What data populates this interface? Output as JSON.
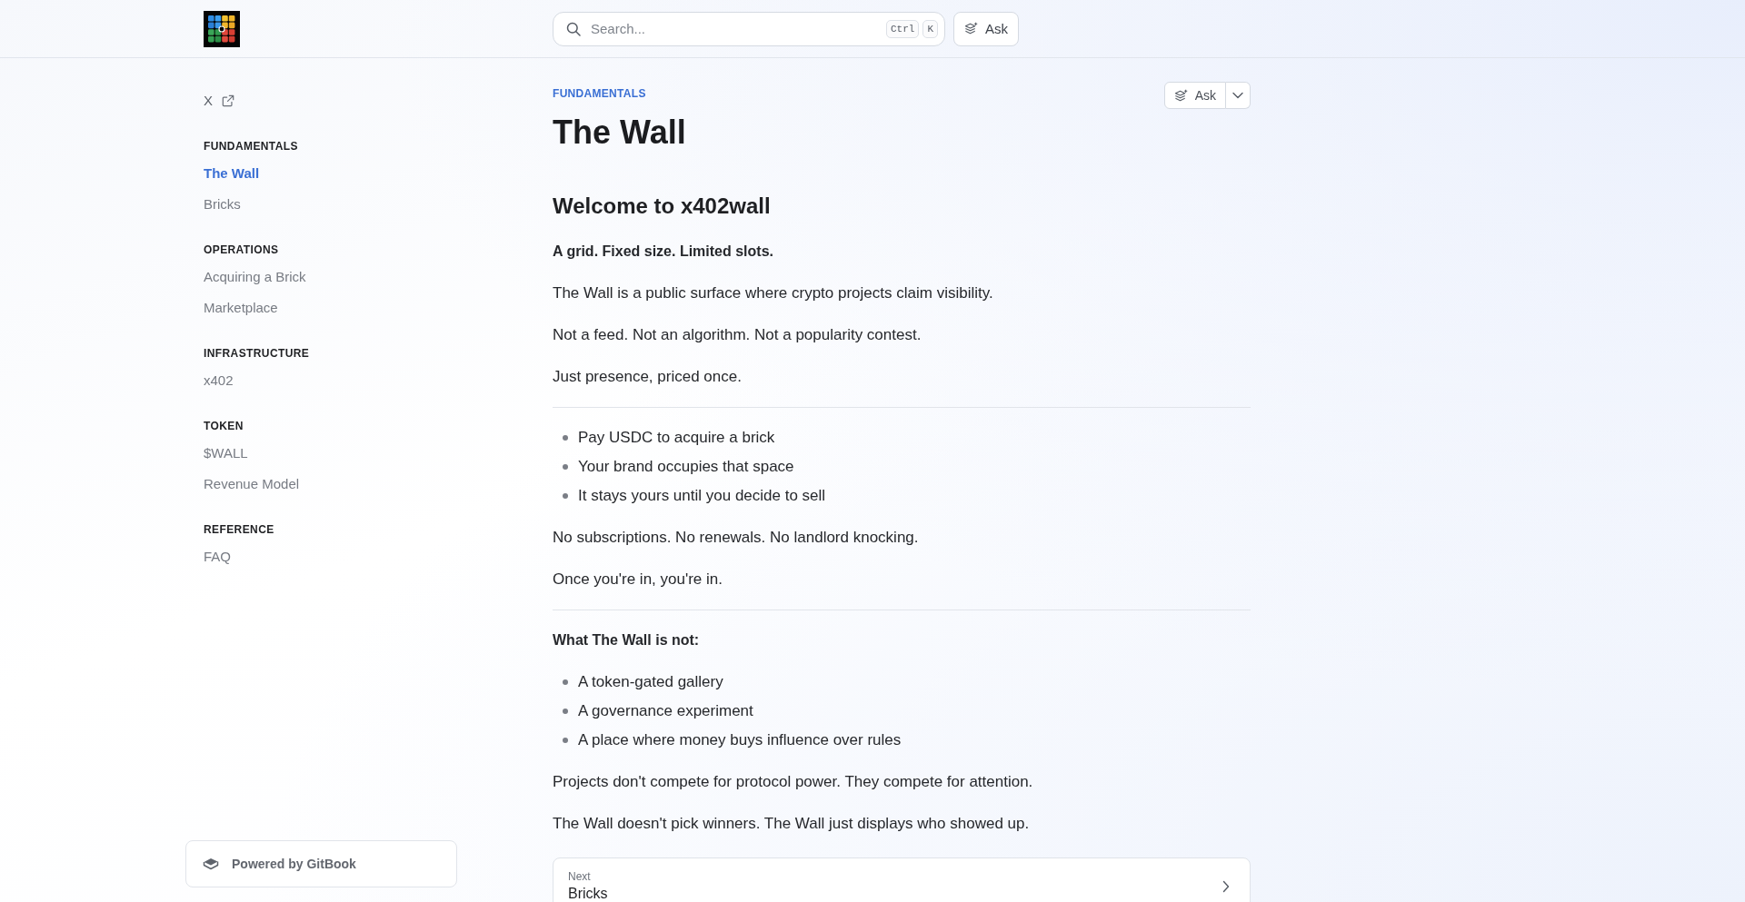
{
  "header": {
    "search": {
      "placeholder": "Search...",
      "shortcut_keys": [
        "Ctrl",
        "K"
      ]
    },
    "ask_button": "Ask"
  },
  "sidebar": {
    "links": [
      {
        "label": "X"
      }
    ],
    "sections": [
      {
        "heading": "FUNDAMENTALS",
        "items": [
          {
            "label": "The Wall",
            "selected": true
          },
          {
            "label": "Bricks",
            "selected": false
          }
        ]
      },
      {
        "heading": "OPERATIONS",
        "items": [
          {
            "label": "Acquiring a Brick",
            "selected": false
          },
          {
            "label": "Marketplace",
            "selected": false
          }
        ]
      },
      {
        "heading": "INFRASTRUCTURE",
        "items": [
          {
            "label": "x402",
            "selected": false
          }
        ]
      },
      {
        "heading": "TOKEN",
        "items": [
          {
            "label": "$WALL",
            "selected": false
          },
          {
            "label": "Revenue Model",
            "selected": false
          }
        ]
      },
      {
        "heading": "REFERENCE",
        "items": [
          {
            "label": "FAQ",
            "selected": false
          }
        ]
      }
    ],
    "footer": "Powered by GitBook"
  },
  "page": {
    "breadcrumb": "FUNDAMENTALS",
    "ask_button": "Ask",
    "title": "The Wall",
    "blocks": [
      {
        "kind": "heading",
        "text": "Welcome to x402wall"
      },
      {
        "kind": "strong",
        "text": "A grid. Fixed size. Limited slots."
      },
      {
        "kind": "paragraph",
        "text": "The Wall is a public surface where crypto projects claim visibility."
      },
      {
        "kind": "paragraph",
        "text": "Not a feed. Not an algorithm. Not a popularity contest."
      },
      {
        "kind": "paragraph",
        "text": "Just presence, priced once."
      },
      {
        "kind": "divider"
      },
      {
        "kind": "list",
        "items": [
          "Pay USDC to acquire a brick",
          "Your brand occupies that space",
          "It stays yours until you decide to sell"
        ]
      },
      {
        "kind": "paragraph",
        "text": "No subscriptions. No renewals. No landlord knocking."
      },
      {
        "kind": "paragraph",
        "text": "Once you're in, you're in."
      },
      {
        "kind": "divider"
      },
      {
        "kind": "strong",
        "text": "What The Wall is not:"
      },
      {
        "kind": "list",
        "items": [
          "A token-gated gallery",
          "A governance experiment",
          "A place where money buys influence over rules"
        ]
      },
      {
        "kind": "paragraph",
        "text": "Projects don't compete for protocol power. They compete for attention."
      },
      {
        "kind": "paragraph",
        "text": "The Wall doesn't pick winners. The Wall just displays who showed up."
      }
    ],
    "next": {
      "label": "Next",
      "title": "Bricks"
    }
  }
}
